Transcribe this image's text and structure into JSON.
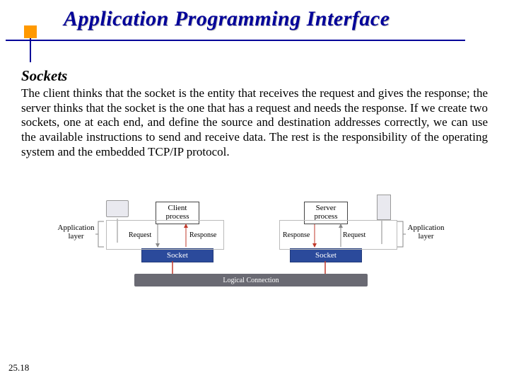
{
  "title": "Application Programming Interface",
  "subhead": "Sockets",
  "body": "The client thinks that the socket is the entity that receives the request and gives the response; the server thinks that the socket is the one that has a request and needs the response. If we create two sockets, one at each end, and define the source and destination addresses correctly, we can use the available instructions to send and receive data. The rest is the responsibility of the operating system and the embedded TCP/IP protocol.",
  "diagram": {
    "app_layer_left": "Application\nlayer",
    "app_layer_right": "Application\nlayer",
    "client_process": "Client\nprocess",
    "server_process": "Server\nprocess",
    "socket": "Socket",
    "request": "Request",
    "response": "Response",
    "logical_connection": "Logical Connection"
  },
  "page_number": "25.18"
}
